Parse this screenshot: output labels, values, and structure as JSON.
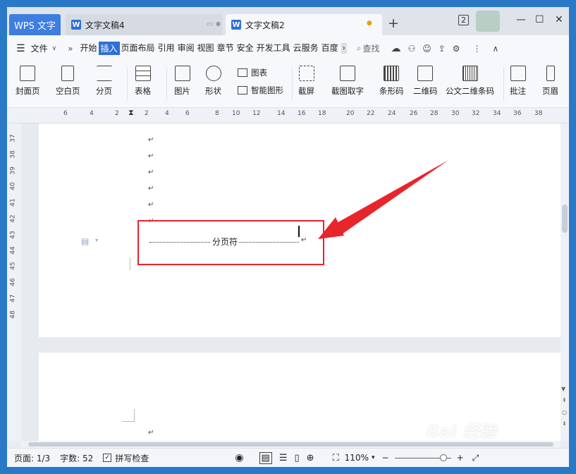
{
  "tabs": {
    "app_label": "WPS 文字",
    "doc1": "文字文稿4",
    "doc2": "文字文稿2",
    "new_tab": "+"
  },
  "window_controls": {
    "counter": "2",
    "minimize": "—",
    "maximize": "☐",
    "close": "✕"
  },
  "menubar": {
    "file_menu": "文件",
    "expand": "»",
    "items": [
      "开始",
      "插入",
      "页面布局",
      "引用",
      "审阅",
      "视图",
      "章节",
      "安全",
      "开发工具",
      "云服务",
      "百度"
    ],
    "active": "插入",
    "search": "查找"
  },
  "ribbon": {
    "cover": "封面页",
    "blank": "空白页",
    "pagebreak": "分页",
    "table": "表格",
    "picture": "图片",
    "shape": "形状",
    "chart": "图表",
    "smartart": "智能图形",
    "screenshot": "截屏",
    "ocr": "截图取字",
    "barcode": "条形码",
    "qrcode": "二维码",
    "pdf417": "公文二维条码",
    "comment": "批注",
    "header": "页眉"
  },
  "ruler": {
    "h_labels": [
      "6",
      "4",
      "2",
      "2",
      "4",
      "6",
      "8",
      "10",
      "12",
      "14",
      "16",
      "18",
      "20",
      "22",
      "24",
      "26",
      "28",
      "30",
      "32",
      "34",
      "36",
      "38"
    ],
    "v_labels": [
      "37",
      "38",
      "39",
      "40",
      "41",
      "42",
      "43",
      "44",
      "45",
      "46",
      "47",
      "48"
    ]
  },
  "document": {
    "page_break_label": "分页符",
    "paragraph_mark": "↵"
  },
  "status": {
    "page": "页面: 1/3",
    "words": "字数: 52",
    "spellcheck": "拼写检查",
    "zoom": "110%",
    "zoom_minus": "−",
    "zoom_plus": "+"
  },
  "watermark": "Bai 经验",
  "colors": {
    "accent": "#2f6fd8",
    "highlight_box": "#e8252b",
    "arrow": "#e8252b",
    "desktop": "#2a78c8"
  }
}
